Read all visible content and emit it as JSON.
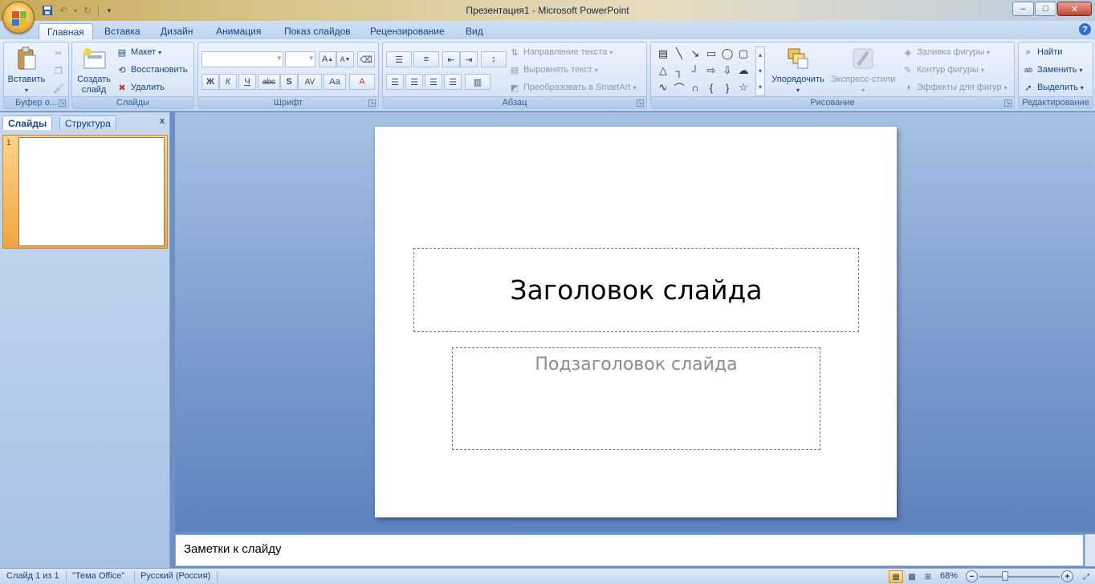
{
  "window": {
    "title": "Презентация1 - Microsoft PowerPoint",
    "minimize": "–",
    "maximize": "□",
    "close": "✕"
  },
  "ribbon_tabs": [
    "Главная",
    "Вставка",
    "Дизайн",
    "Анимация",
    "Показ слайдов",
    "Рецензирование",
    "Вид"
  ],
  "active_tab": "Главная",
  "help": "?",
  "groups": {
    "clipboard": {
      "label": "Буфер о...",
      "paste": "Вставить"
    },
    "slides": {
      "label": "Слайды",
      "new_slide_line1": "Создать",
      "new_slide_line2": "слайд",
      "layout": "Макет",
      "reset": "Восстановить",
      "delete": "Удалить"
    },
    "font": {
      "label": "Шрифт",
      "font_name": "",
      "font_size": "",
      "bold": "Ж",
      "italic": "К",
      "underline": "Ч",
      "strike": "abc",
      "shadow": "S",
      "spacing": "AV",
      "case": "Aa",
      "color": "A",
      "grow": "A",
      "shrink": "A"
    },
    "paragraph": {
      "label": "Абзац",
      "text_direction": "Направление текста",
      "align_text": "Выровнять текст",
      "smartart": "Преобразовать в SmartArt"
    },
    "drawing": {
      "label": "Рисование",
      "arrange": "Упорядочить",
      "quick_styles": "Экспресс-стили",
      "shape_fill": "Заливка фигуры",
      "shape_outline": "Контур фигуры",
      "shape_effects": "Эффекты для фигур"
    },
    "editing": {
      "label": "Редактирование",
      "find": "Найти",
      "replace": "Заменить",
      "select": "Выделить"
    }
  },
  "left_panel": {
    "tab_slides": "Слайды",
    "tab_outline": "Структура",
    "close": "x",
    "slide_number": "1"
  },
  "slide": {
    "title": "Заголовок слайда",
    "subtitle": "Подзаголовок слайда"
  },
  "notes": {
    "placeholder": "Заметки к слайду"
  },
  "status": {
    "slide_info": "Слайд 1 из 1",
    "theme": "\"Тема Office\"",
    "language": "Русский (Россия)",
    "zoom": "68%",
    "zoom_out": "−",
    "zoom_in": "+"
  },
  "colors": {
    "accent": "#15428b",
    "ribbon": "#d3e2f6",
    "workspace": "#7c9ccf",
    "thumb_selected": "#f3a440"
  }
}
